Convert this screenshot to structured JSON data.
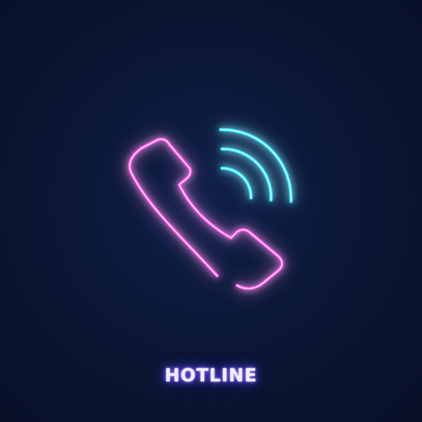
{
  "icon": {
    "name": "phone-ringing-icon",
    "handset_color": "#ff4fe8",
    "waves_color": "#27e3ff"
  },
  "label": {
    "text": "HOTLINE",
    "color": "#f2ecff",
    "glow": "#6a4dff"
  },
  "background": {
    "color": "#0a1230"
  }
}
